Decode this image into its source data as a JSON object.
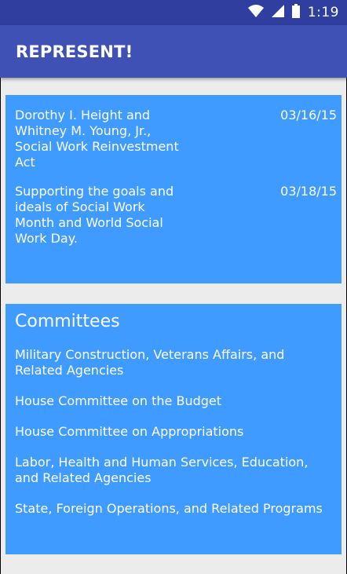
{
  "status_bar": {
    "time": "1:19",
    "icons": [
      "wifi-icon",
      "signal-icon",
      "battery-icon"
    ]
  },
  "app_bar": {
    "title": "REPRESENT!"
  },
  "bills": [
    {
      "title": "Dorothy I. Height and Whitney M. Young, Jr., Social Work Reinvestment Act",
      "date": "03/16/15"
    },
    {
      "title": "Supporting the goals and ideals of Social Work Month and World Social Work Day.",
      "date": "03/18/15"
    }
  ],
  "committees": {
    "heading": "Committees",
    "items": [
      "Military Construction, Veterans Affairs, and Related Agencies",
      "House Committee on the Budget",
      "House Committee on Appropriations",
      "Labor, Health and Human Services, Education, and Related Agencies",
      "State, Foreign Operations, and Related Programs"
    ]
  },
  "colors": {
    "status_bar": "#303f9f",
    "app_bar": "#3f51b5",
    "card": "#3f9bff",
    "background": "#ececec"
  }
}
